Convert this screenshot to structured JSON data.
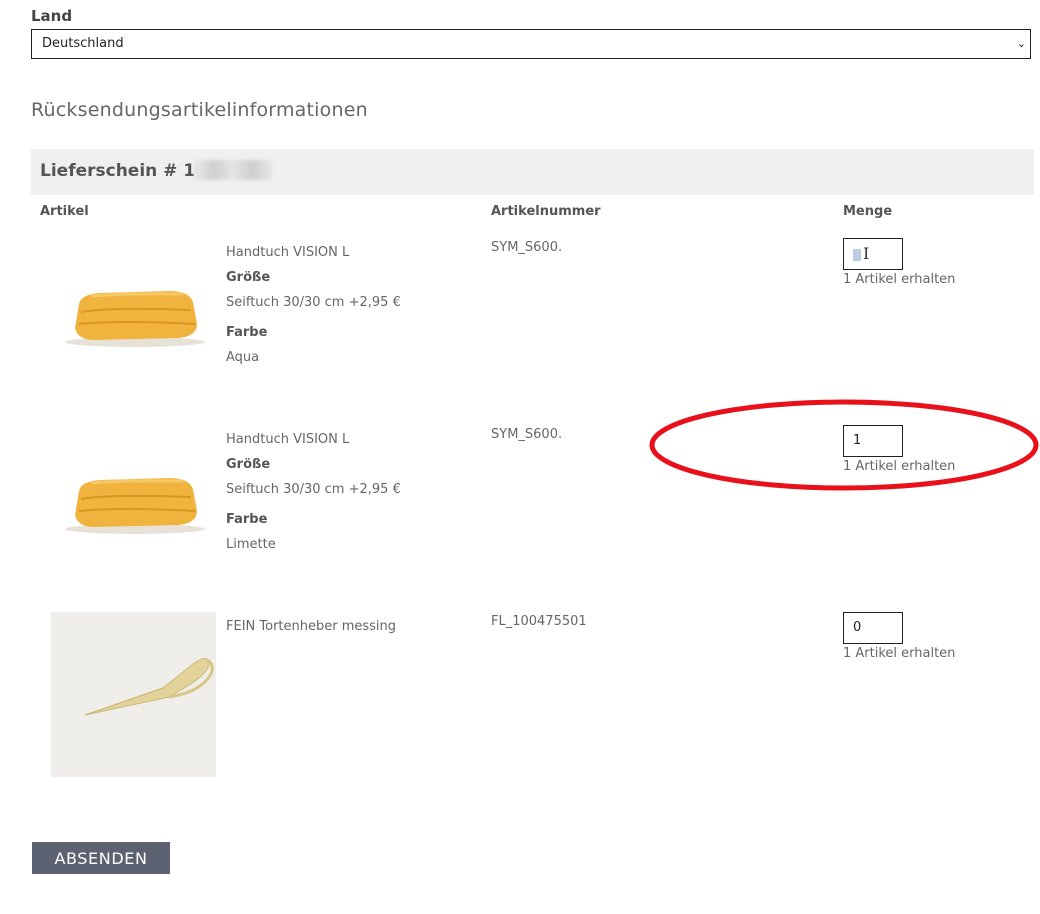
{
  "land": {
    "label": "Land",
    "value": "Deutschland"
  },
  "section_title": "Rücksendungsartikelinformationen",
  "lieferschein": {
    "title": "Lieferschein # 102"
  },
  "columns": {
    "artikel": "Artikel",
    "artikelnummer": "Artikelnummer",
    "menge": "Menge"
  },
  "items": [
    {
      "name": "Handtuch VISION L",
      "size_label": "Größe",
      "size_value": "Seiftuch 30/30 cm +2,95 €",
      "color_label": "Farbe",
      "color_value": "Aqua",
      "sku": "SYM_S600.",
      "qty": "",
      "received": "1 Artikel erhalten",
      "image": "towel-yellow"
    },
    {
      "name": "Handtuch VISION L",
      "size_label": "Größe",
      "size_value": "Seiftuch 30/30 cm +2,95 €",
      "color_label": "Farbe",
      "color_value": "Limette",
      "sku": "SYM_S600.",
      "qty": "1",
      "received": "1 Artikel erhalten",
      "image": "towel-yellow"
    },
    {
      "name": "FEIN Tortenheber messing",
      "sku": "FL_100475501",
      "qty": "0",
      "received": "1 Artikel erhalten",
      "image": "cake-server-brass"
    }
  ],
  "submit_label": "ABSENDEN",
  "icons": {
    "select": "chevron-down-icon",
    "cursor": "text-cursor-icon"
  },
  "colors": {
    "annotation": "#e8101a",
    "button": "#5c6272",
    "bar": "#f0f0f0"
  }
}
